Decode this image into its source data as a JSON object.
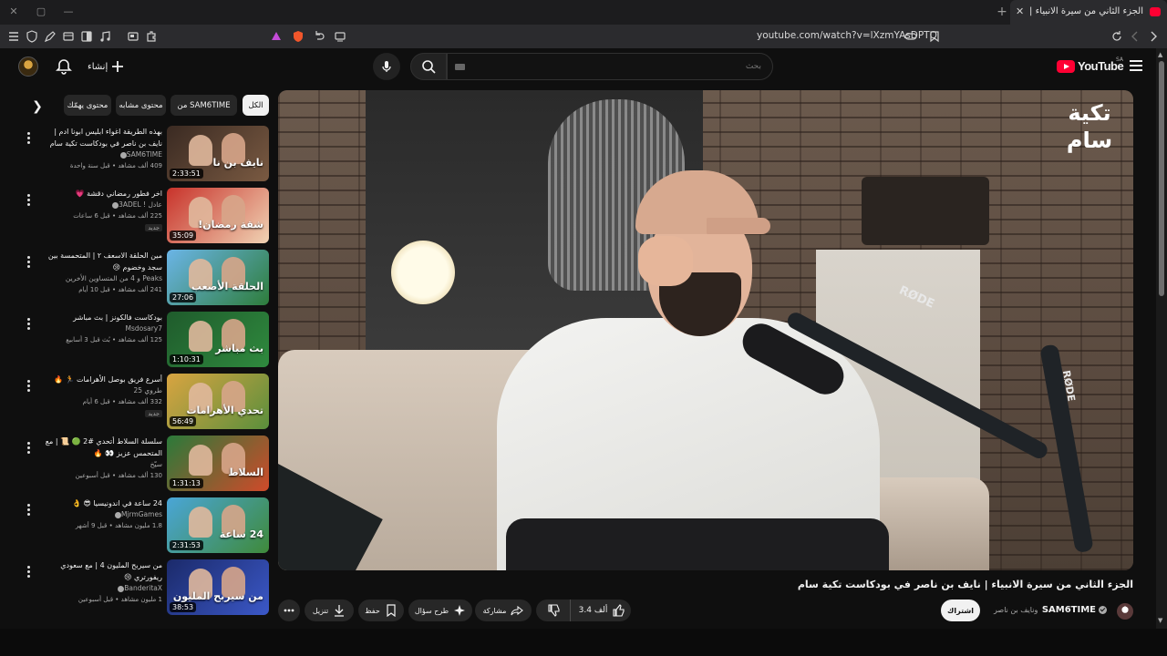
{
  "browser": {
    "tab_title": "الجزء الثاني من سيرة الانبياء | نايف",
    "url": "youtube.com/watch?v=lXzmYAsDPTQ",
    "new_tab_symbol": "+",
    "tab_close_symbol": "✕"
  },
  "header": {
    "logo_text": "YouTube",
    "logo_country": "SA",
    "search_placeholder": "بحث",
    "create_label": "إنشاء"
  },
  "chips": [
    {
      "label": "الكل",
      "active": true
    },
    {
      "label": "من SAM6TIME",
      "active": false
    },
    {
      "label": "محتوى مشابه",
      "active": false
    },
    {
      "label": "محتوى يهمّك",
      "active": false
    }
  ],
  "related": [
    {
      "title": "بهذه الطريقة اغواء ابليس ابونا ادم | نايف بن ناصر في بودكاست تكية سام",
      "channel": "SAM6TIME",
      "verified": true,
      "meta": "409 ألف مشاهد • قبل سنة واحدة",
      "duration": "2:33:51",
      "badge": "",
      "thumb_colors": [
        "#3a2a22",
        "#7a5a42"
      ],
      "thumb_text": "نايف بن نا"
    },
    {
      "title": "اخر فطور رمضاني دقشة 💗",
      "channel": "عادل ! 3ADEL",
      "verified": true,
      "meta": "225 ألف مشاهد • قبل 6 ساعات",
      "duration": "35:09",
      "badge": "جديد",
      "thumb_colors": [
        "#c8322a",
        "#f0d3b4"
      ],
      "thumb_text": "شقة رمضان!"
    },
    {
      "title": "مين الحلقة الاسعف ٢ | المتحمسة بين سجد وخضوم 😢",
      "channel": "Peaks و 4 من المتساوين الأخرين",
      "verified": false,
      "meta": "241 ألف مشاهد • قبل 10 أيام",
      "duration": "27:06",
      "badge": "",
      "thumb_colors": [
        "#6bb5e8",
        "#2e7d3b"
      ],
      "thumb_text": "الحلقة الأصعب"
    },
    {
      "title": "بودكاست فالكونز | بث مباشر",
      "channel": "Msdosary7",
      "verified": false,
      "meta": "125 ألف مشاهد • بُث قبل 3 أسابيع",
      "duration": "1:10:31",
      "badge": "",
      "thumb_colors": [
        "#1f5b2c",
        "#2f8a3e"
      ],
      "thumb_text": "بث مباشر"
    },
    {
      "title": "أسرع فريق بوصل الأهرامات 🏃 🔥",
      "channel": "طروي 25",
      "verified": false,
      "meta": "332 ألف مشاهد • قبل 6 أيام",
      "duration": "56:49",
      "badge": "جديد",
      "thumb_colors": [
        "#d9a441",
        "#5a8f3c"
      ],
      "thumb_text": "تحدي الأهرامات"
    },
    {
      "title": "سلسلة السلاط أتحدي #2 🟢 📜 | مع المتحمس عزيز 👀 🔥",
      "channel": "سيّخ",
      "verified": false,
      "meta": "130 ألف مشاهد • قبل أسبوعين",
      "duration": "1:31:13",
      "badge": "",
      "thumb_colors": [
        "#2a7a3a",
        "#d04a2a"
      ],
      "thumb_text": "السلاط"
    },
    {
      "title": "24 ساعة في اندونيسيا 😎 👌",
      "channel": "MjrmGames",
      "verified": true,
      "meta": "1.8 مليون مشاهد • قبل 9 أشهر",
      "duration": "2:31:53",
      "badge": "",
      "thumb_colors": [
        "#4aa6d8",
        "#3f8a3a"
      ],
      "thumb_text": "24 ساعة"
    },
    {
      "title": "من سيربح المليون 4 | مع سعودي ريفورتري 😢",
      "channel": "BanderitaX",
      "verified": true,
      "meta": "1 مليون مشاهد • قبل أسبوعين",
      "duration": "38:53",
      "badge": "",
      "thumb_colors": [
        "#1b2a6a",
        "#3b58c8"
      ],
      "thumb_text": "من سيربح المليون"
    }
  ],
  "video": {
    "title": "الجزء الثاني من سيرة الانبياء | نايف بن ناصر في بودكاست تكية سام",
    "watermark": "تكية سام",
    "mic_brand": "RØDE",
    "channel": "SAM6TIME",
    "subscribers": "ونايف بن ناصر",
    "subscribe_label": "اشتراك",
    "likes": "3.4 ألف",
    "share_label": "مشاركة",
    "ask_label": "طرح سؤال",
    "save_label": "حفظ",
    "download_label": "تنزيل"
  }
}
